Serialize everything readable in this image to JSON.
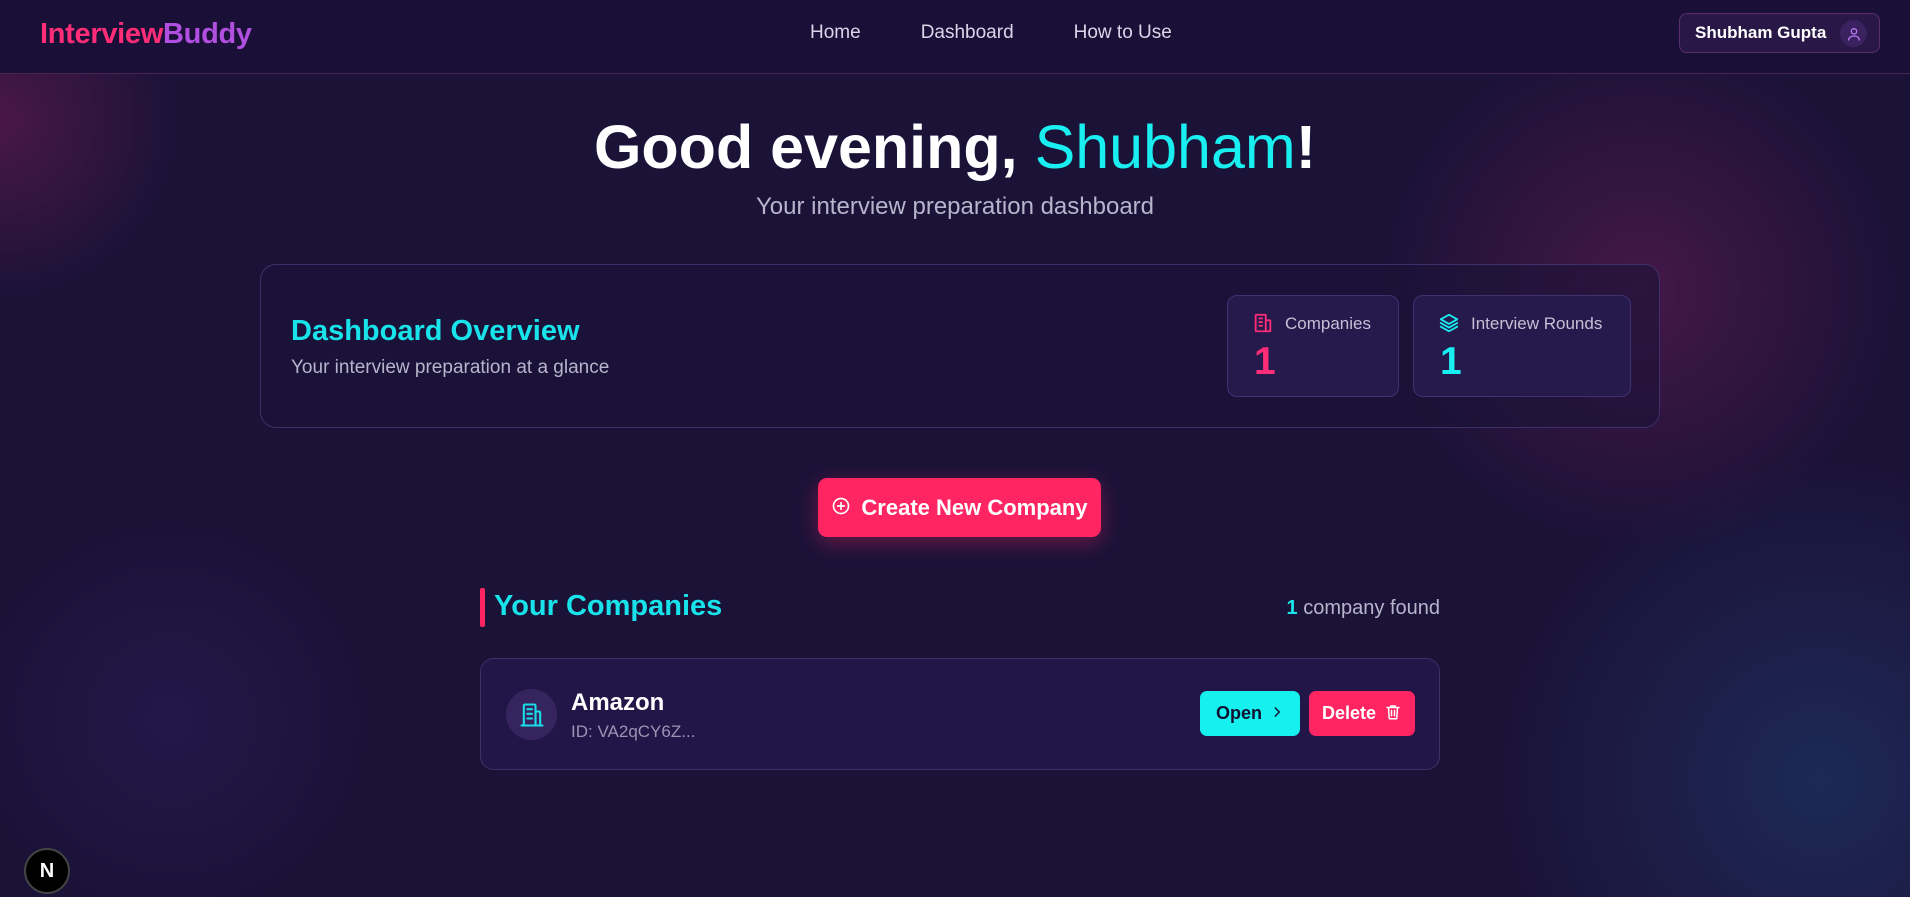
{
  "nav": {
    "logo_part1": "Interview",
    "logo_part2": "Buddy",
    "links": [
      "Home",
      "Dashboard",
      "How to Use"
    ],
    "user_name": "Shubham Gupta",
    "user_icon": "user-icon"
  },
  "hero": {
    "greeting_prefix": "Good evening, ",
    "greeting_name": "Shubham",
    "greeting_suffix": "!",
    "subtitle": "Your interview preparation dashboard"
  },
  "overview": {
    "title": "Dashboard Overview",
    "subtitle": "Your interview preparation at a glance",
    "stats": [
      {
        "label": "Companies",
        "value": "1",
        "icon": "building-icon",
        "color": "#ff2d78"
      },
      {
        "label": "Interview Rounds",
        "value": "1",
        "icon": "layers-icon",
        "color": "#19eef0"
      }
    ]
  },
  "actions": {
    "create_label": "Create New Company",
    "create_icon": "plus-circle-icon"
  },
  "companies": {
    "title": "Your Companies",
    "count": "1",
    "count_suffix": " company found",
    "items": [
      {
        "name": "Amazon",
        "id": "ID: VA2qCY6Z...",
        "open_label": "Open",
        "delete_label": "Delete"
      }
    ]
  },
  "badge": {
    "label": "N"
  },
  "colors": {
    "background": "#1b1238",
    "accent_pink": "#ff2462",
    "accent_cyan": "#19eef0",
    "logo_purple": "#b04fe0"
  }
}
